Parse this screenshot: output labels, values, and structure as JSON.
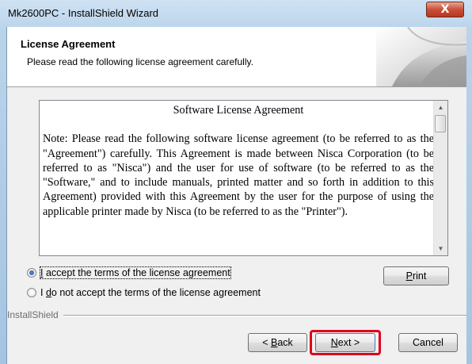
{
  "window": {
    "title": "Mk2600PC - InstallShield Wizard",
    "close_glyph": "X"
  },
  "header": {
    "title": "License Agreement",
    "subtitle": "Please read the following license agreement carefully."
  },
  "license": {
    "heading": "Software License Agreement",
    "body": "Note: Please read the following software license agreement (to be referred to as the \"Agreement\") carefully.  This Agreement is made between Nisca Corporation (to be referred to as \"Nisca\") and the user for use of software (to be referred to as the \"Software,\" and to include manuals, printed matter and so forth in addition to this Agreement) provided with this Agreement by the user for the purpose of using the applicable printer made by Nisca (to be referred to as the \"Printer\")."
  },
  "options": {
    "accept": {
      "pre": "",
      "accel": "I",
      "post": " accept the terms of the license agreement",
      "checked": true
    },
    "decline": {
      "pre": "I ",
      "accel": "d",
      "post": "o not accept the terms of the license agreement",
      "checked": false
    }
  },
  "buttons": {
    "print": {
      "accel": "P",
      "rest": "rint"
    },
    "back": {
      "pre": "< ",
      "accel": "B",
      "rest": "ack"
    },
    "next": {
      "accel": "N",
      "rest": "ext >"
    },
    "cancel": "Cancel"
  },
  "footer": {
    "brand": "InstallShield"
  },
  "colors": {
    "highlight": "#e0001a",
    "title_bar": "#b9d3ea",
    "close_button": "#c9503a"
  }
}
